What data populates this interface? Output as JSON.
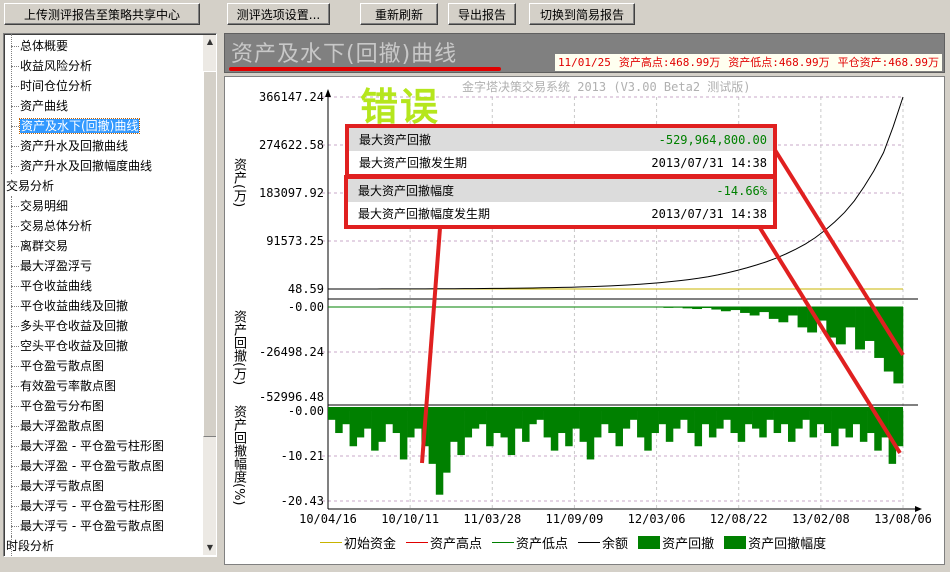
{
  "toolbar": {
    "upload": "上传测评报告至策略共享中心",
    "options": "测评选项设置...",
    "refresh": "重新刷新",
    "export": "导出报告",
    "switch": "切换到简易报告"
  },
  "sidebar": {
    "items": [
      {
        "label": "总体概要",
        "level": 1
      },
      {
        "label": "收益风险分析",
        "level": 1
      },
      {
        "label": "时间仓位分析",
        "level": 1
      },
      {
        "label": "资产曲线",
        "level": 1
      },
      {
        "label": "资产及水下(回撤)曲线",
        "level": 1,
        "selected": true
      },
      {
        "label": "资产升水及回撤曲线",
        "level": 1
      },
      {
        "label": "资产升水及回撤幅度曲线",
        "level": 1
      },
      {
        "label": "交易分析",
        "level": 0
      },
      {
        "label": "交易明细",
        "level": 1
      },
      {
        "label": "交易总体分析",
        "level": 1
      },
      {
        "label": "离群交易",
        "level": 1
      },
      {
        "label": "最大浮盈浮亏",
        "level": 1
      },
      {
        "label": "平仓收益曲线",
        "level": 1
      },
      {
        "label": "平仓收益曲线及回撤",
        "level": 1
      },
      {
        "label": "多头平仓收益及回撤",
        "level": 1
      },
      {
        "label": "空头平仓收益及回撤",
        "level": 1
      },
      {
        "label": "平仓盈亏散点图",
        "level": 1
      },
      {
        "label": "有效盈亏率散点图",
        "level": 1
      },
      {
        "label": "平仓盈亏分布图",
        "level": 1
      },
      {
        "label": "最大浮盈散点图",
        "level": 1
      },
      {
        "label": "最大浮盈 - 平仓盈亏柱形图",
        "level": 1
      },
      {
        "label": "最大浮盈 - 平仓盈亏散点图",
        "level": 1
      },
      {
        "label": "最大浮亏散点图",
        "level": 1
      },
      {
        "label": "最大浮亏 - 平仓盈亏柱形图",
        "level": 1
      },
      {
        "label": "最大浮亏 - 平仓盈亏散点图",
        "level": 1
      },
      {
        "label": "时段分析",
        "level": 0
      }
    ]
  },
  "header": {
    "title": "资产及水下(回撤)曲线",
    "date": "11/01/25",
    "high": "资产高点:468.99万",
    "low": "资产低点:468.99万",
    "close": "平仓资产:468.99万"
  },
  "watermark": "金字塔决策交易系统 2013 (V3.00 Beta2 测试版)",
  "annotation": "错误",
  "summary": [
    {
      "label": "最大资产回撤",
      "value": "-529,964,800.00",
      "green": true
    },
    {
      "label": "最大资产回撤发生期",
      "value": "2013/07/31  14:38"
    },
    {
      "label": "最大资产回撤幅度",
      "value": "-14.66%",
      "green": true
    },
    {
      "label": "最大资产回撤幅度发生期",
      "value": "2013/07/31  14:38"
    }
  ],
  "colors": {
    "accent_red": "#e02020",
    "drawdown_green": "#008000",
    "selection": "#3399ff"
  },
  "chart_data": [
    {
      "type": "line",
      "ylabel": "资产(万)",
      "yticks": [
        "366147.24",
        "274622.58",
        "183097.92",
        "91573.25",
        "48.59"
      ],
      "ylim": [
        48.59,
        366147.24
      ],
      "x_range": [
        "10/04/16",
        "13/08/06"
      ],
      "series": [
        {
          "name": "余额",
          "values": [
            48,
            60,
            80,
            100,
            130,
            160,
            200,
            240,
            290,
            340,
            400,
            470,
            550,
            640,
            740,
            860,
            1000,
            1150,
            1330,
            1530,
            1760,
            2020,
            2320,
            2660,
            3050,
            3500,
            4000,
            4600,
            5300,
            6100,
            7000,
            8000,
            9200,
            10500,
            12000,
            13800,
            15800,
            18000,
            20500,
            23500,
            27000,
            31000,
            35500,
            40500,
            46000,
            52000,
            59000,
            67000,
            76000,
            86000,
            98000,
            112000,
            128000,
            146000,
            168000,
            195000,
            225000,
            260000,
            310000,
            366147
          ]
        },
        {
          "name": "初始资金",
          "values": [
            48.59
          ]
        }
      ]
    },
    {
      "type": "area",
      "ylabel": "资产回撤(万)",
      "yticks": [
        "-0.00",
        "-26498.24",
        "-52996.48"
      ],
      "ylim": [
        -52996.48,
        0
      ],
      "series": [
        {
          "name": "资产回撤",
          "values": [
            0,
            0,
            0,
            0,
            0,
            0,
            0,
            0,
            0,
            0,
            0,
            0,
            0,
            0,
            0,
            0,
            0,
            0,
            0,
            0,
            0,
            0,
            0,
            0,
            0,
            0,
            0,
            0,
            0,
            0,
            -50,
            -100,
            -200,
            -150,
            -300,
            -500,
            -400,
            -800,
            -1200,
            -600,
            -1500,
            -2500,
            -1800,
            -3500,
            -5000,
            -3000,
            -7000,
            -9000,
            -5000,
            -12000,
            -15000,
            -8000,
            -18000,
            -22000,
            -12000,
            -25000,
            -20000,
            -30000,
            -38000,
            -45000
          ]
        }
      ]
    },
    {
      "type": "area",
      "ylabel": "资产回撤幅度(%)",
      "yticks": [
        "-0.00",
        "-10.21",
        "-20.43"
      ],
      "ylim": [
        -20.43,
        0
      ],
      "series": [
        {
          "name": "资产回撤幅度",
          "values": [
            -2,
            -5,
            -3,
            -8,
            -6,
            -4,
            -9,
            -7,
            -3,
            -5,
            -11,
            -6,
            -4,
            -8,
            -12,
            -19,
            -14,
            -7,
            -10,
            -6,
            -4,
            -3,
            -8,
            -5,
            -6,
            -10,
            -4,
            -7,
            -3,
            -2,
            -6,
            -9,
            -5,
            -8,
            -4,
            -7,
            -11,
            -6,
            -3,
            -5,
            -8,
            -4,
            -2,
            -6,
            -9,
            -5,
            -3,
            -7,
            -4,
            -2,
            -5,
            -8,
            -3,
            -6,
            -4,
            -2,
            -5,
            -7,
            -3,
            -4,
            -6,
            -2,
            -5,
            -3,
            -7,
            -4,
            -2,
            -6,
            -3,
            -5,
            -8,
            -4,
            -6,
            -3,
            -7,
            -5,
            -9,
            -6,
            -12,
            -8
          ]
        }
      ]
    }
  ],
  "xticks": [
    "10/04/16",
    "10/10/11",
    "11/03/28",
    "11/09/09",
    "12/03/06",
    "12/08/22",
    "13/02/08",
    "13/08/06"
  ],
  "legend": [
    {
      "label": "初始资金",
      "color": "#c8b400",
      "kind": "line"
    },
    {
      "label": "资产高点",
      "color": "#e00000",
      "kind": "line"
    },
    {
      "label": "资产低点",
      "color": "#008000",
      "kind": "line"
    },
    {
      "label": "余额",
      "color": "#000000",
      "kind": "line"
    },
    {
      "label": "资产回撤",
      "color": "#008000",
      "kind": "box"
    },
    {
      "label": "资产回撤幅度",
      "color": "#008000",
      "kind": "box"
    }
  ]
}
